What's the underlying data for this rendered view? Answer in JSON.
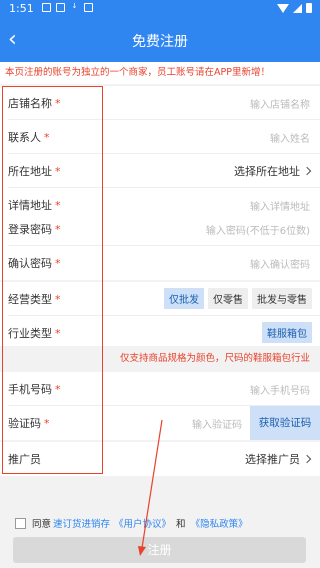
{
  "status": {
    "time": "1:51",
    "icons": [
      "image-icon",
      "mail-icon",
      "download-icon",
      "app-icon"
    ]
  },
  "header": {
    "back": "‹",
    "title": "免费注册"
  },
  "notice": "本页注册的账号为独立的一个商家，员工账号请在APP里新增！",
  "required_mark": "*",
  "fields": {
    "store_name": {
      "label": "店铺名称",
      "placeholder": "输入店铺名称"
    },
    "contact": {
      "label": "联系人",
      "placeholder": "输入姓名"
    },
    "address": {
      "label": "所在地址",
      "value": "选择所在地址"
    },
    "detail_address": {
      "label": "详情地址",
      "placeholder": "输入详情地址"
    },
    "password": {
      "label": "登录密码",
      "placeholder": "输入密码(不低于6位数)"
    },
    "confirm_password": {
      "label": "确认密码",
      "placeholder": "输入确认密码"
    },
    "business_type": {
      "label": "经营类型",
      "options": [
        "仅批发",
        "仅零售",
        "批发与零售"
      ],
      "selected": "仅批发"
    },
    "industry_type": {
      "label": "行业类型",
      "value": "鞋服箱包"
    },
    "phone": {
      "label": "手机号码",
      "placeholder": "输入手机号码"
    },
    "code": {
      "label": "验证码",
      "placeholder": "输入验证码",
      "button": "获取验证码"
    },
    "promoter": {
      "label": "推广员",
      "value": "选择推广员"
    }
  },
  "industry_note": "仅支持商品规格为颜色，尺码的鞋服箱包行业",
  "agreement": {
    "prefix": "同意",
    "app": "速订货进销存",
    "user": "《用户协议》",
    "and": "和",
    "privacy": "《隐私政策》"
  },
  "register_button": "注册",
  "colors": {
    "primary": "#2f86f0",
    "warning": "#e8412c",
    "chip_active": "#cde0f7",
    "button_disabled": "#d9d9d9"
  }
}
